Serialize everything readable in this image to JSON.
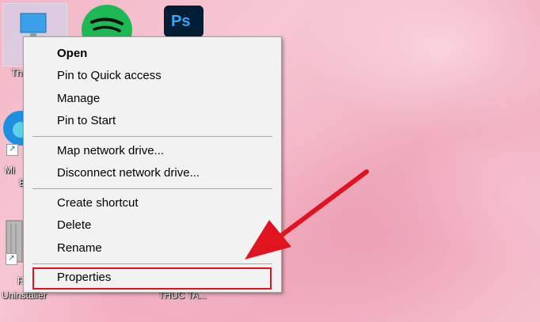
{
  "desktop": {
    "icons": [
      {
        "name": "this-pc-icon",
        "label": "Th"
      },
      {
        "name": "spotify-icon",
        "label": ""
      },
      {
        "name": "photoshop-icon",
        "label": "",
        "glyph": "Ps"
      },
      {
        "name": "edge-icon",
        "label_line1": "Mi",
        "label_line2": "E"
      },
      {
        "name": "uninstaller-icon",
        "label_line1": "R",
        "label_line2": "Uninstaller"
      },
      {
        "name": "folder-shortcut-label",
        "label": "THUC TA..."
      }
    ]
  },
  "context_menu": {
    "groups": [
      [
        "Open",
        "Pin to Quick access",
        "Manage",
        "Pin to Start"
      ],
      [
        "Map network drive...",
        "Disconnect network drive..."
      ],
      [
        "Create shortcut",
        "Delete",
        "Rename"
      ],
      [
        "Properties"
      ]
    ],
    "default_item": "Open",
    "highlighted_item": "Properties"
  },
  "annotation": {
    "arrow_color": "#e0141e",
    "highlight_color": "#e0141e"
  }
}
